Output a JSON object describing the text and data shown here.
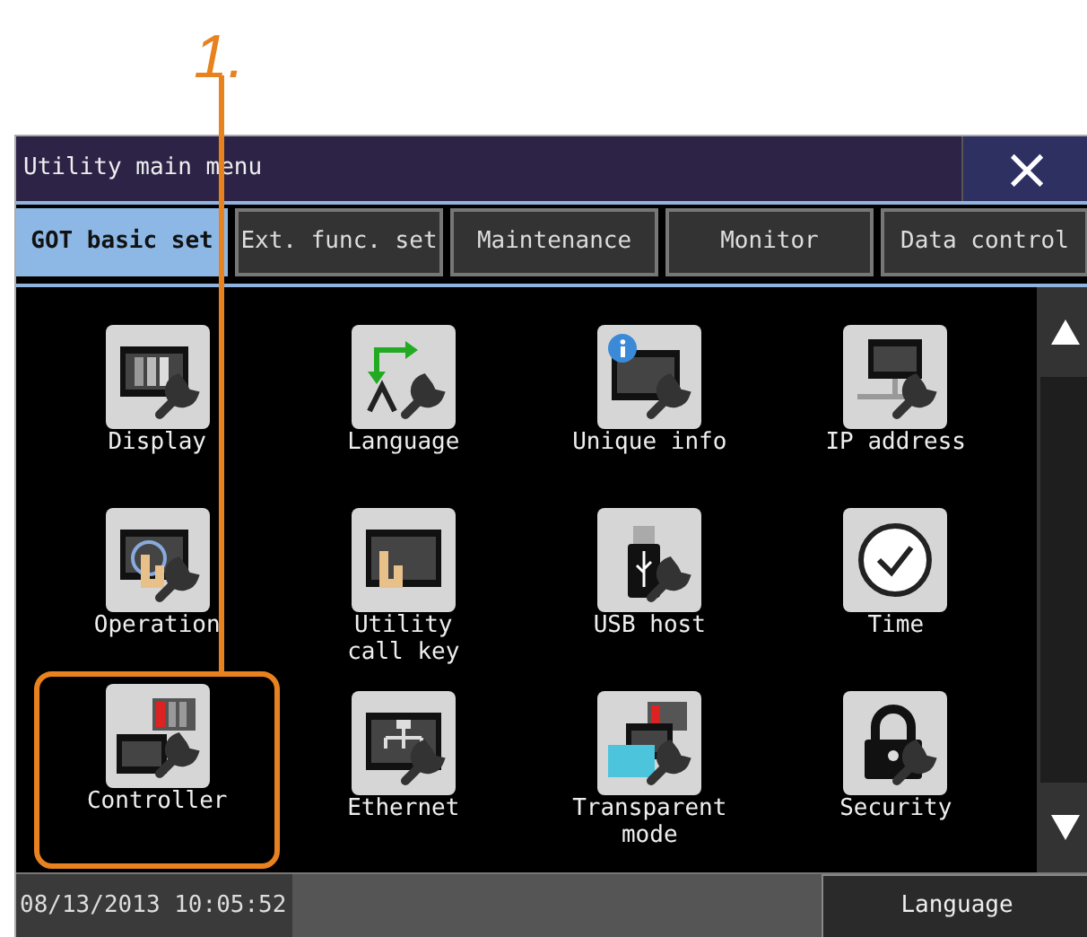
{
  "annotation": {
    "label": "1."
  },
  "window": {
    "title": "Utility main menu",
    "close": "×"
  },
  "tabs": [
    {
      "label": "GOT basic set",
      "selected": true
    },
    {
      "label": "Ext. func. set",
      "selected": false
    },
    {
      "label": "Maintenance",
      "selected": false
    },
    {
      "label": "Monitor",
      "selected": false
    },
    {
      "label": "Data control",
      "selected": false
    }
  ],
  "items": [
    {
      "label": "Display",
      "highlighted": false
    },
    {
      "label": "Language",
      "highlighted": false
    },
    {
      "label": "Unique info",
      "highlighted": false
    },
    {
      "label": "IP address",
      "highlighted": false
    },
    {
      "label": "Operation",
      "highlighted": false
    },
    {
      "label": "Utility\ncall key",
      "highlighted": false
    },
    {
      "label": "USB host",
      "highlighted": false
    },
    {
      "label": "Time",
      "highlighted": false
    },
    {
      "label": "Controller",
      "highlighted": true
    },
    {
      "label": "Ethernet",
      "highlighted": false
    },
    {
      "label": "Transparent\nmode",
      "highlighted": false
    },
    {
      "label": "Security",
      "highlighted": false
    }
  ],
  "status_bar": {
    "datetime": "08/13/2013 10:05:52",
    "language_button": "Language"
  }
}
